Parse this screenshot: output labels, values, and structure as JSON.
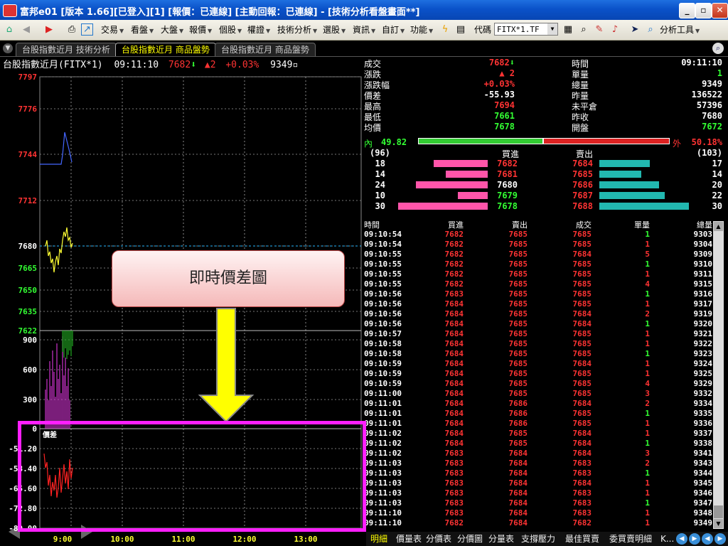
{
  "window": {
    "title": "富邦e01 [版本 1.66][已登入][1] [報價：已連線] [主動回報：已連線] - [技術分析看盤畫面**]",
    "controls": [
      "_",
      "▫",
      "✕"
    ]
  },
  "toolbar": {
    "menus": [
      "交易",
      "看盤",
      "大盤",
      "報價",
      "個股",
      "權證",
      "技術分析",
      "選股",
      "資訊",
      "自訂",
      "功能"
    ],
    "code_label": "代碼",
    "code_value": "FITX*1.TF",
    "analysis_tools": "分析工具"
  },
  "tabs": [
    "台股指數近月 技術分析",
    "台股指數近月 商品盤勢",
    "台股指數近月 商品盤勢"
  ],
  "chart": {
    "symbol": "台股指數近月(FITX*1)",
    "time": "09:11:10",
    "price": "7682",
    "change": "2",
    "change_pct": "+0.03%",
    "volume": "9349",
    "price_axis": [
      "7797",
      "7776",
      "7744",
      "7712",
      "7680",
      "7665",
      "7650",
      "7635",
      "7622"
    ],
    "volume_axis": [
      "900",
      "600",
      "300"
    ],
    "diff_axis": [
      "0",
      "-51.20",
      "-58.40",
      "-65.60",
      "-72.80",
      "-80.00"
    ],
    "diff_label": "價差",
    "time_axis": [
      "9:00",
      "10:00",
      "11:00",
      "12:00",
      "13:00"
    ]
  },
  "quote": {
    "left": [
      {
        "label": "成交",
        "value": "7682",
        "color": "#ff3333",
        "arrow": "down"
      },
      {
        "label": "漲跌",
        "value": "▲ 2",
        "color": "#ff3333"
      },
      {
        "label": "漲跌幅",
        "value": "+0.03%",
        "color": "#ff3333"
      },
      {
        "label": "價差",
        "value": "-55.93",
        "color": "#ffffff"
      },
      {
        "label": "最高",
        "value": "7694",
        "color": "#ff3333"
      },
      {
        "label": "最低",
        "value": "7661",
        "color": "#33ff33"
      },
      {
        "label": "均價",
        "value": "7678",
        "color": "#33ff33"
      }
    ],
    "right": [
      {
        "label": "時間",
        "value": "09:11:10",
        "color": "#ffffff"
      },
      {
        "label": "單量",
        "value": "1",
        "color": "#33ff33"
      },
      {
        "label": "總量",
        "value": "9349",
        "color": "#ffffff"
      },
      {
        "label": "昨量",
        "value": "136522",
        "color": "#ffffff"
      },
      {
        "label": "未平倉",
        "value": "57396",
        "color": "#ffffff"
      },
      {
        "label": "昨收",
        "value": "7680",
        "color": "#ffffff"
      },
      {
        "label": "開盤",
        "value": "7672",
        "color": "#33ff33"
      }
    ],
    "inner_label": "內",
    "inner_pct": "49.82",
    "outer_label": "外",
    "outer_pct": "50.18%",
    "inner_fraction": 0.4982,
    "bid_total": "(96)",
    "ask_total": "(103)",
    "bid_header": "買進",
    "ask_header": "賣出",
    "bids": [
      {
        "qty": "18",
        "price": "7682",
        "color": "#ff3333"
      },
      {
        "qty": "14",
        "price": "7681",
        "color": "#ff3333"
      },
      {
        "qty": "24",
        "price": "7680",
        "color": "#ffffff"
      },
      {
        "qty": "10",
        "price": "7679",
        "color": "#33ff33"
      },
      {
        "qty": "30",
        "price": "7678",
        "color": "#33ff33"
      }
    ],
    "asks": [
      {
        "price": "7684",
        "qty": "17"
      },
      {
        "price": "7685",
        "qty": "14"
      },
      {
        "price": "7686",
        "qty": "20"
      },
      {
        "price": "7687",
        "qty": "22"
      },
      {
        "price": "7688",
        "qty": "30"
      }
    ]
  },
  "ticks": {
    "headers": [
      "時間",
      "買進",
      "賣出",
      "成交",
      "單量",
      "總量"
    ],
    "rows": [
      [
        "09:10:54",
        "7682",
        "7685",
        "7685",
        "1",
        "9303"
      ],
      [
        "09:10:54",
        "7682",
        "7685",
        "7685",
        "1",
        "9304"
      ],
      [
        "09:10:55",
        "7682",
        "7685",
        "7684",
        "5",
        "9309"
      ],
      [
        "09:10:55",
        "7682",
        "7685",
        "7685",
        "1",
        "9310"
      ],
      [
        "09:10:55",
        "7682",
        "7685",
        "7685",
        "1",
        "9311"
      ],
      [
        "09:10:55",
        "7682",
        "7685",
        "7685",
        "4",
        "9315"
      ],
      [
        "09:10:56",
        "7683",
        "7685",
        "7685",
        "1",
        "9316"
      ],
      [
        "09:10:56",
        "7684",
        "7685",
        "7685",
        "1",
        "9317"
      ],
      [
        "09:10:56",
        "7684",
        "7685",
        "7684",
        "2",
        "9319"
      ],
      [
        "09:10:56",
        "7684",
        "7685",
        "7684",
        "1",
        "9320"
      ],
      [
        "09:10:57",
        "7684",
        "7685",
        "7685",
        "1",
        "9321"
      ],
      [
        "09:10:58",
        "7684",
        "7685",
        "7685",
        "1",
        "9322"
      ],
      [
        "09:10:58",
        "7684",
        "7685",
        "7685",
        "1",
        "9323"
      ],
      [
        "09:10:59",
        "7684",
        "7685",
        "7684",
        "1",
        "9324"
      ],
      [
        "09:10:59",
        "7684",
        "7685",
        "7685",
        "1",
        "9325"
      ],
      [
        "09:10:59",
        "7684",
        "7685",
        "7685",
        "4",
        "9329"
      ],
      [
        "09:11:00",
        "7684",
        "7685",
        "7685",
        "3",
        "9332"
      ],
      [
        "09:11:01",
        "7684",
        "7686",
        "7684",
        "2",
        "9334"
      ],
      [
        "09:11:01",
        "7684",
        "7686",
        "7685",
        "1",
        "9335"
      ],
      [
        "09:11:01",
        "7684",
        "7686",
        "7685",
        "1",
        "9336"
      ],
      [
        "09:11:02",
        "7684",
        "7685",
        "7684",
        "1",
        "9337"
      ],
      [
        "09:11:02",
        "7684",
        "7685",
        "7684",
        "1",
        "9338"
      ],
      [
        "09:11:02",
        "7683",
        "7684",
        "7684",
        "3",
        "9341"
      ],
      [
        "09:11:03",
        "7683",
        "7684",
        "7683",
        "2",
        "9343"
      ],
      [
        "09:11:03",
        "7683",
        "7684",
        "7683",
        "1",
        "9344"
      ],
      [
        "09:11:03",
        "7683",
        "7684",
        "7684",
        "1",
        "9345"
      ],
      [
        "09:11:03",
        "7683",
        "7684",
        "7683",
        "1",
        "9346"
      ],
      [
        "09:11:03",
        "7683",
        "7684",
        "7683",
        "1",
        "9347"
      ],
      [
        "09:11:10",
        "7683",
        "7684",
        "7683",
        "1",
        "9348"
      ],
      [
        "09:11:10",
        "7682",
        "7684",
        "7682",
        "1",
        "9349"
      ]
    ]
  },
  "bottom_tabs": [
    "明細",
    "價量表",
    "分價表",
    "分價圖",
    "分量表",
    "支撐壓力",
    "最佳買賣",
    "委買賣明細",
    "K..."
  ],
  "callout": "即時價差圖",
  "colors": {
    "up": "#ff3333",
    "down": "#33ff33",
    "highlight": "#ff1fff",
    "arrow": "#ffff00"
  }
}
